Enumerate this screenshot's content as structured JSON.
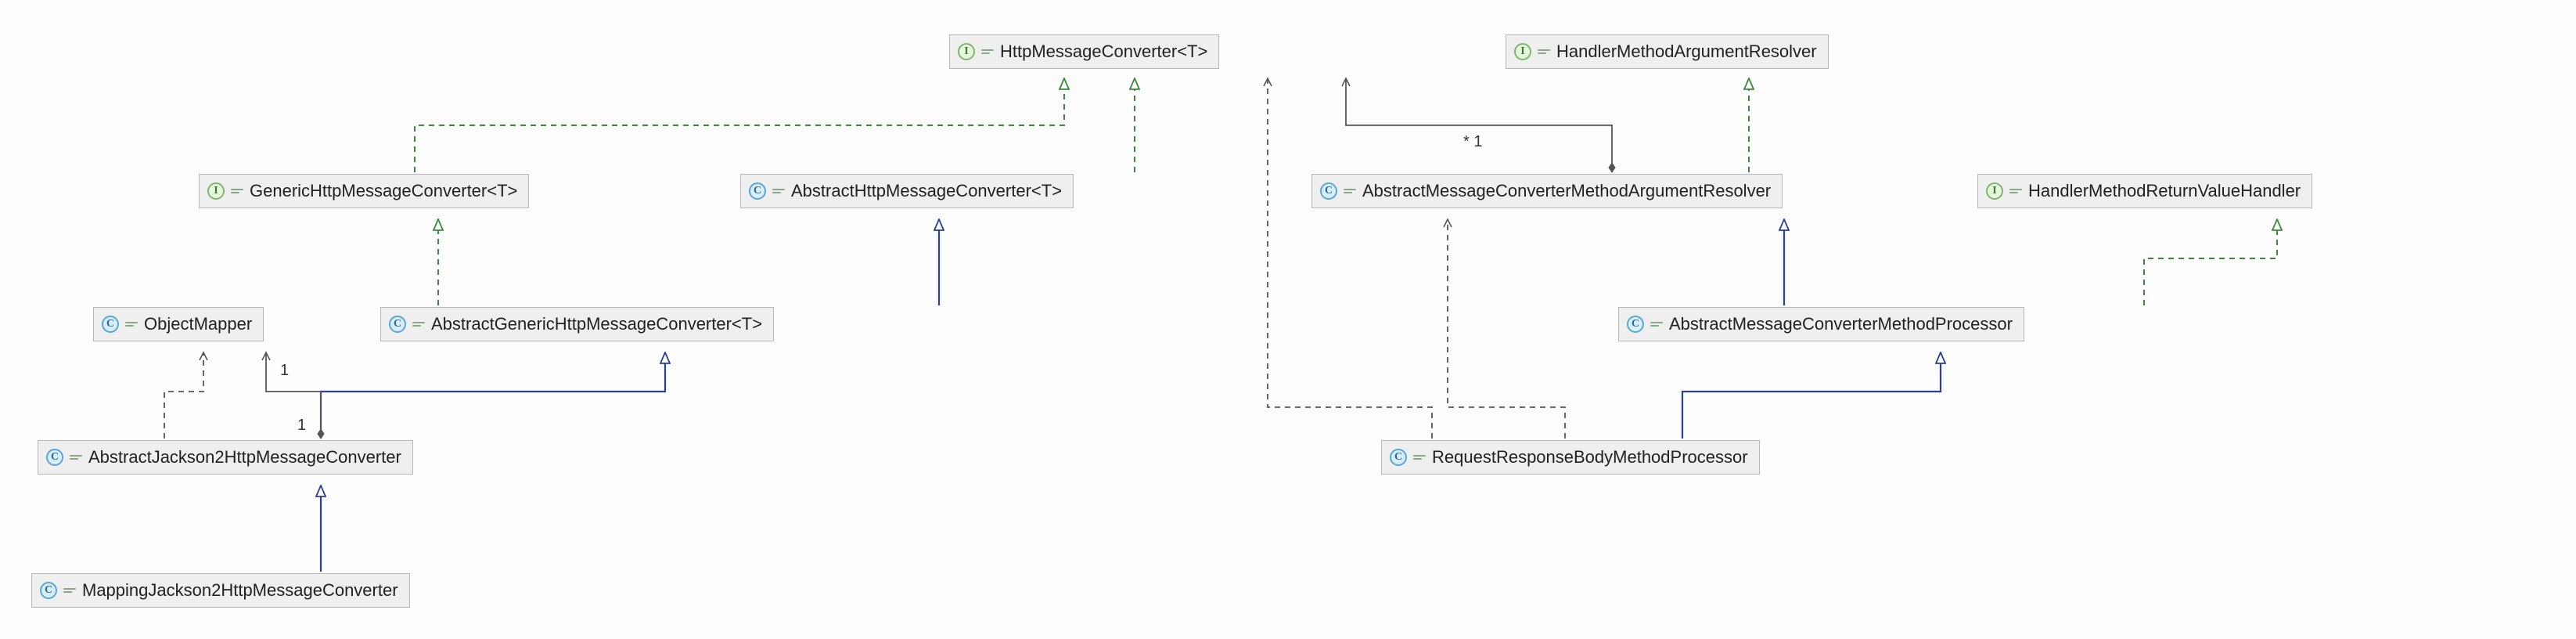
{
  "badges": {
    "class_letter": "C",
    "interface_letter": "I"
  },
  "nodes": {
    "httpMessageConverter": {
      "kind": "iface",
      "label": "HttpMessageConverter<T>"
    },
    "handlerMethodArgumentResolver": {
      "kind": "iface",
      "label": "HandlerMethodArgumentResolver"
    },
    "genericHttpMessageConverter": {
      "kind": "iface",
      "label": "GenericHttpMessageConverter<T>"
    },
    "abstractHttpMessageConverter": {
      "kind": "class",
      "label": "AbstractHttpMessageConverter<T>"
    },
    "abstractMessageConverterMethodArgumentResolver": {
      "kind": "class",
      "label": "AbstractMessageConverterMethodArgumentResolver"
    },
    "handlerMethodReturnValueHandler": {
      "kind": "iface",
      "label": "HandlerMethodReturnValueHandler"
    },
    "objectMapper": {
      "kind": "class",
      "label": "ObjectMapper"
    },
    "abstractGenericHttpMessageConverter": {
      "kind": "class",
      "label": "AbstractGenericHttpMessageConverter<T>"
    },
    "abstractMessageConverterMethodProcessor": {
      "kind": "class",
      "label": "AbstractMessageConverterMethodProcessor"
    },
    "abstractJackson2HttpMessageConverter": {
      "kind": "class",
      "label": "AbstractJackson2HttpMessageConverter"
    },
    "requestResponseBodyMethodProcessor": {
      "kind": "class",
      "label": "RequestResponseBodyMethodProcessor"
    },
    "mappingJackson2HttpMessageConverter": {
      "kind": "class",
      "label": "MappingJackson2HttpMessageConverter"
    }
  },
  "assoc_labels": {
    "one_top": "1",
    "one_bottom": "1",
    "star_one": "*  1"
  },
  "colors": {
    "implements": "#3a8a3a",
    "extends": "#2a3f9a",
    "uses": "#555555"
  }
}
